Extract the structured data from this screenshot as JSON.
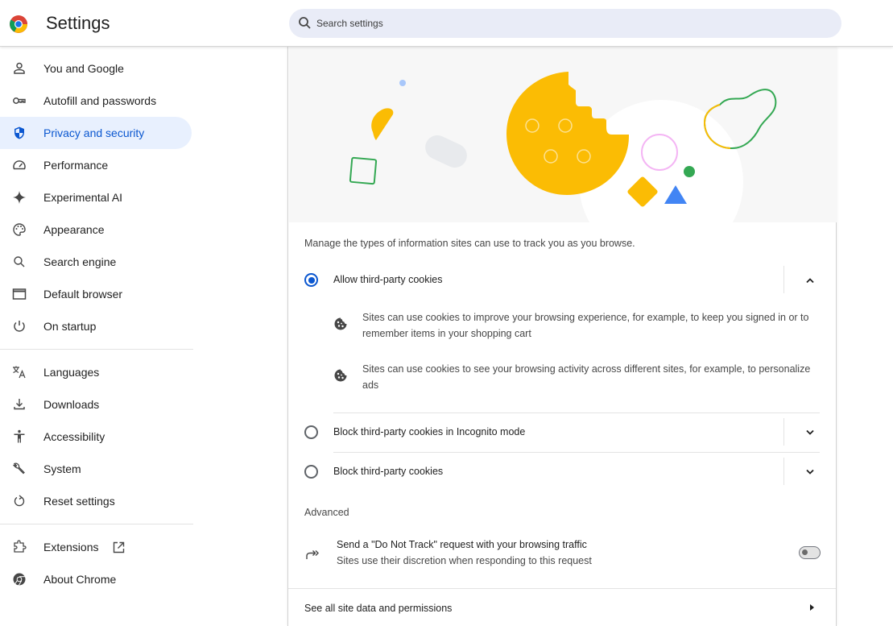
{
  "header": {
    "title": "Settings",
    "search_placeholder": "Search settings",
    "search_value": ""
  },
  "sidebar": {
    "items": [
      {
        "label": "You and Google",
        "icon": "person-icon"
      },
      {
        "label": "Autofill and passwords",
        "icon": "key-icon"
      },
      {
        "label": "Privacy and security",
        "icon": "shield-icon",
        "active": true
      },
      {
        "label": "Performance",
        "icon": "speedometer-icon"
      },
      {
        "label": "Experimental AI",
        "icon": "sparkle-icon"
      },
      {
        "label": "Appearance",
        "icon": "palette-icon"
      },
      {
        "label": "Search engine",
        "icon": "search-icon"
      },
      {
        "label": "Default browser",
        "icon": "browser-window-icon"
      },
      {
        "label": "On startup",
        "icon": "power-icon"
      },
      {
        "label": "Languages",
        "icon": "translate-icon"
      },
      {
        "label": "Downloads",
        "icon": "download-icon"
      },
      {
        "label": "Accessibility",
        "icon": "accessibility-icon"
      },
      {
        "label": "System",
        "icon": "wrench-icon"
      },
      {
        "label": "Reset settings",
        "icon": "reset-icon"
      },
      {
        "label": "Extensions",
        "icon": "puzzle-icon"
      },
      {
        "label": "About Chrome",
        "icon": "chrome-icon"
      }
    ]
  },
  "content": {
    "description": "Manage the types of information sites can use to track you as you browse.",
    "options": [
      {
        "label": "Allow third-party cookies",
        "checked": true,
        "expanded": true,
        "details": [
          "Sites can use cookies to improve your browsing experience, for example, to keep you signed in or to remember items in your shopping cart",
          "Sites can use cookies to see your browsing activity across different sites, for example, to personalize ads"
        ]
      },
      {
        "label": "Block third-party cookies in Incognito mode",
        "checked": false,
        "expanded": false
      },
      {
        "label": "Block third-party cookies",
        "checked": false,
        "expanded": false
      }
    ],
    "advanced": {
      "title": "Advanced",
      "dnt_title": "Send a \"Do Not Track\" request with your browsing traffic",
      "dnt_subtitle": "Sites use their discretion when responding to this request",
      "dnt_enabled": false
    },
    "see_all_label": "See all site data and permissions"
  },
  "colors": {
    "accent": "#0b57d0",
    "active_bg": "#e8f0fe",
    "search_bg": "#e9ecf7",
    "cookie_yellow": "#fbbc04",
    "green": "#34a853",
    "blue": "#4285f4",
    "pink": "#f4b5f4"
  }
}
